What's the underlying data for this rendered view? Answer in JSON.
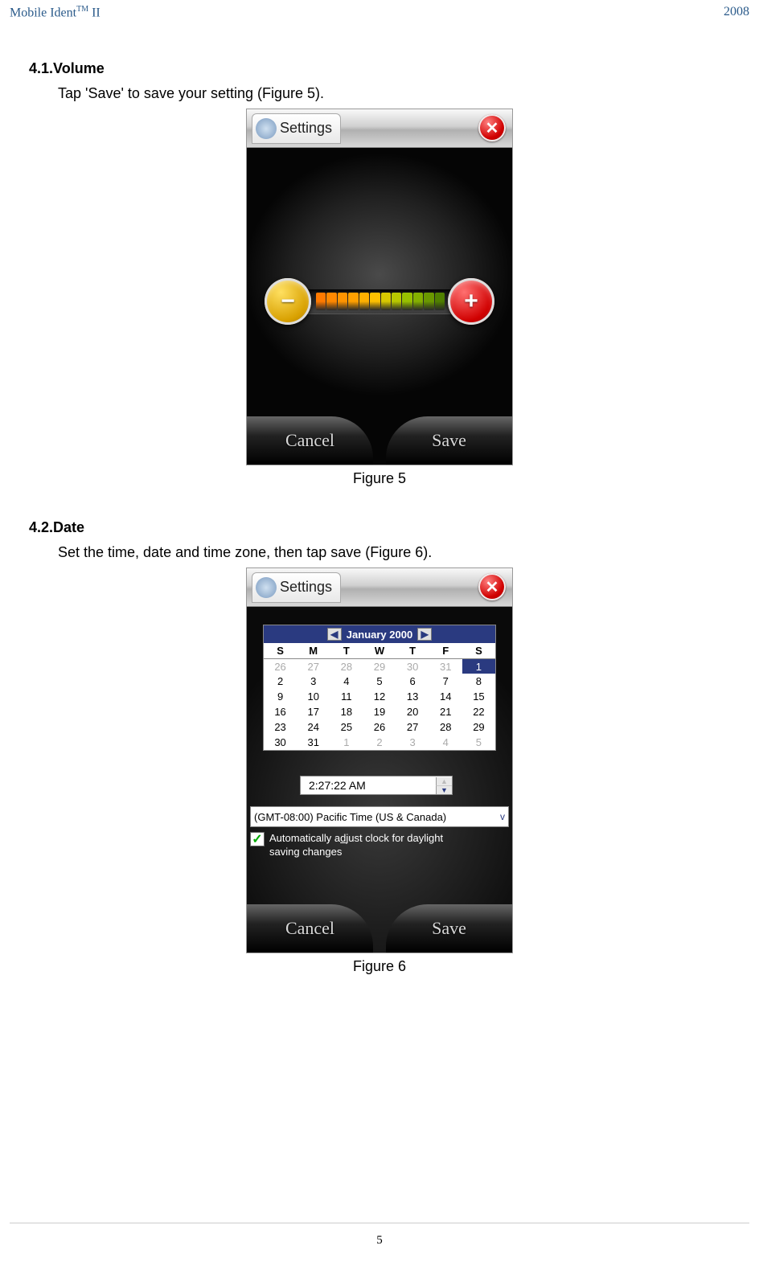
{
  "header": {
    "left_title": "Mobile Ident",
    "left_suffix": " II",
    "right_year": "2008",
    "tm": "TM"
  },
  "sections": {
    "volume": {
      "num": "4.1.",
      "title": "Volume",
      "body": "Tap 'Save' to save your setting (Figure 5).",
      "caption": "Figure 5"
    },
    "date": {
      "num": "4.2.",
      "title": "Date",
      "body": "Set the time, date and time zone, then tap save (Figure 6).",
      "caption": "Figure 6"
    }
  },
  "device_common": {
    "settings_label": "Settings",
    "cancel": "Cancel",
    "save": "Save",
    "close_glyph": "✕"
  },
  "volume_device": {
    "plus": "+",
    "minus": "−",
    "segment_colors": [
      "#ff7a00",
      "#ff8800",
      "#ff9400",
      "#ffa000",
      "#ffb000",
      "#ffc000",
      "#d8c800",
      "#b8c800",
      "#98c000",
      "#84b000",
      "#6a9800",
      "#508000"
    ]
  },
  "date_device": {
    "month_label": "January 2000",
    "prev": "◀",
    "next": "▶",
    "dow": [
      "S",
      "M",
      "T",
      "W",
      "T",
      "F",
      "S"
    ],
    "weeks": [
      [
        {
          "d": "26",
          "dim": true
        },
        {
          "d": "27",
          "dim": true
        },
        {
          "d": "28",
          "dim": true
        },
        {
          "d": "29",
          "dim": true
        },
        {
          "d": "30",
          "dim": true
        },
        {
          "d": "31",
          "dim": true
        },
        {
          "d": "1",
          "sel": true
        }
      ],
      [
        {
          "d": "2"
        },
        {
          "d": "3"
        },
        {
          "d": "4"
        },
        {
          "d": "5"
        },
        {
          "d": "6"
        },
        {
          "d": "7"
        },
        {
          "d": "8"
        }
      ],
      [
        {
          "d": "9"
        },
        {
          "d": "10"
        },
        {
          "d": "11"
        },
        {
          "d": "12"
        },
        {
          "d": "13"
        },
        {
          "d": "14"
        },
        {
          "d": "15"
        }
      ],
      [
        {
          "d": "16"
        },
        {
          "d": "17"
        },
        {
          "d": "18"
        },
        {
          "d": "19"
        },
        {
          "d": "20"
        },
        {
          "d": "21"
        },
        {
          "d": "22"
        }
      ],
      [
        {
          "d": "23"
        },
        {
          "d": "24"
        },
        {
          "d": "25"
        },
        {
          "d": "26"
        },
        {
          "d": "27"
        },
        {
          "d": "28"
        },
        {
          "d": "29"
        }
      ],
      [
        {
          "d": "30"
        },
        {
          "d": "31"
        },
        {
          "d": "1",
          "dim": true
        },
        {
          "d": "2",
          "dim": true
        },
        {
          "d": "3",
          "dim": true
        },
        {
          "d": "4",
          "dim": true
        },
        {
          "d": "5",
          "dim": true
        }
      ]
    ],
    "time_value": "2:27:22 AM",
    "timezone": "(GMT-08:00) Pacific Time (US & Canada)",
    "dst_label_1": "Automatically adjust clock for daylight",
    "dst_label_2": "saving changes",
    "dst_key_char": "d",
    "spin_up": "▲",
    "spin_down": "▼",
    "dropdown_glyph": "v"
  },
  "page_number": "5"
}
